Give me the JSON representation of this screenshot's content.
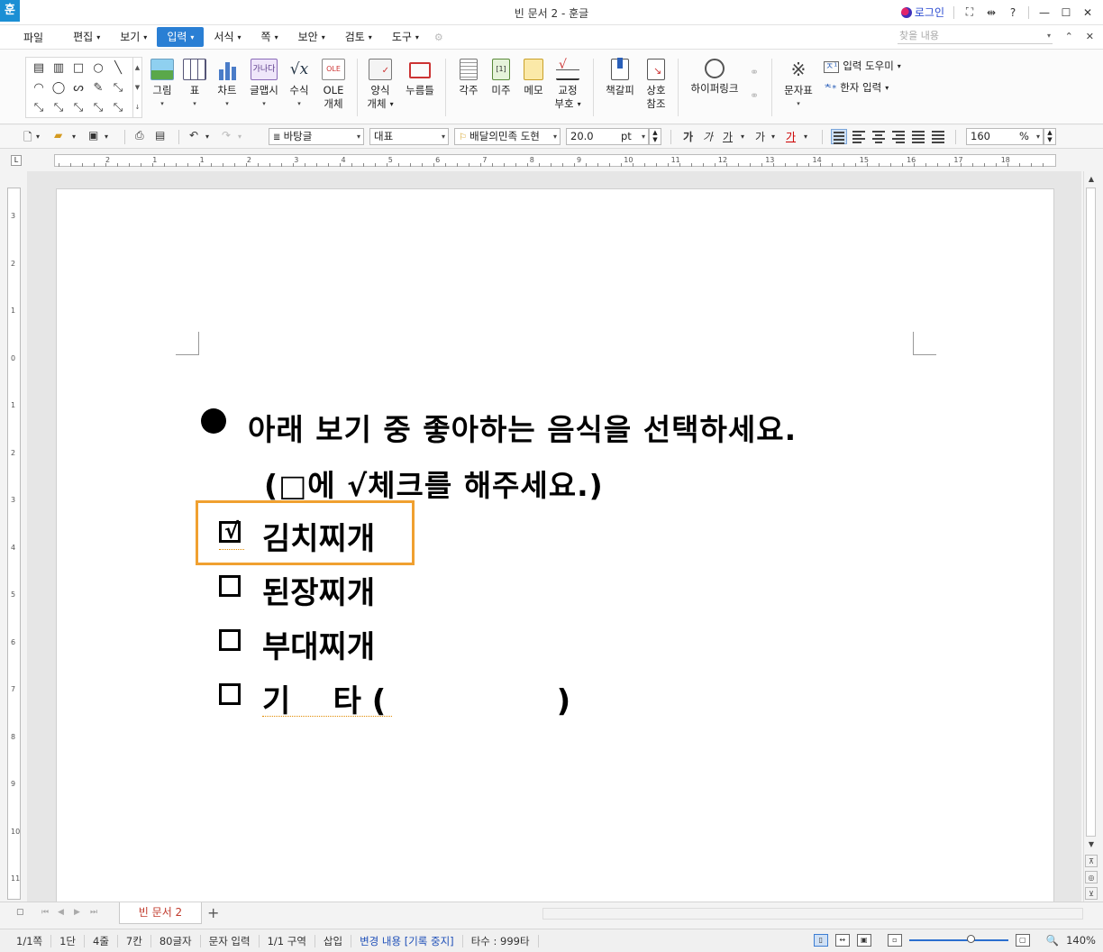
{
  "app": {
    "logo": "훈",
    "title": "빈 문서 2 - 훈글"
  },
  "title_right": {
    "login": "로그인",
    "help": "?"
  },
  "menu": {
    "file": "파일",
    "items": [
      "편집",
      "보기",
      "입력",
      "서식",
      "쪽",
      "보안",
      "검토",
      "도구"
    ],
    "active_index": 2,
    "search_placeholder": "찾을 내용"
  },
  "ribbon": {
    "buttons": [
      {
        "label": "그림",
        "icon": "picture-icon"
      },
      {
        "label": "표",
        "icon": "table-icon"
      },
      {
        "label": "차트",
        "icon": "chart-icon"
      },
      {
        "label": "글맵시",
        "icon": "wordart-icon",
        "glyph": "가나다"
      },
      {
        "label": "수식",
        "icon": "formula-icon",
        "glyph": "√x"
      },
      {
        "label": "OLE",
        "label2": "개체",
        "icon": "ole-icon",
        "glyph": "OLE"
      },
      {
        "label": "양식",
        "label2": "개체",
        "icon": "form-object-icon"
      },
      {
        "label": "누름틀",
        "icon": "click-field-icon"
      },
      {
        "label": "각주",
        "icon": "footnote-icon"
      },
      {
        "label": "미주",
        "icon": "endnote-icon",
        "glyph": "[1]"
      },
      {
        "label": "메모",
        "icon": "memo-icon"
      },
      {
        "label": "교정",
        "label2": "부호",
        "icon": "proofreading-icon"
      },
      {
        "label": "책갈피",
        "icon": "bookmark-icon"
      },
      {
        "label": "상호",
        "label2": "참조",
        "icon": "cross-reference-icon"
      },
      {
        "label": "하이퍼링크",
        "icon": "hyperlink-icon"
      },
      {
        "label": "문자표",
        "icon": "symbol-icon",
        "glyph": "※"
      }
    ],
    "side_items": [
      {
        "label": "입력 도우미",
        "glyph": "ㅈ¹"
      },
      {
        "label": "한자 입력",
        "glyph": "ᅕ*"
      }
    ],
    "shapes": [
      "▤",
      "▥",
      "□",
      "○",
      "╲",
      "◠",
      "◯",
      "ᔕ",
      "✎",
      "⤡",
      "⤡",
      "⤡",
      "⤡",
      "⤡",
      "⤡"
    ]
  },
  "toolbar": {
    "style": "바탕글",
    "lang": "대표",
    "font": "배달의민족 도현",
    "size": "20.0",
    "size_unit": "pt",
    "char_fmt": [
      "가",
      "가",
      "가",
      "가",
      "가"
    ],
    "zoom": "160",
    "zoom_unit": "%"
  },
  "ruler": {
    "h_numbers": [
      "2",
      "1",
      "1",
      "2",
      "3",
      "4",
      "5",
      "6",
      "7",
      "8",
      "9",
      "10",
      "11",
      "12",
      "13",
      "14",
      "15",
      "16",
      "17",
      "18"
    ],
    "v_numbers": [
      "3",
      "2",
      "1",
      "0",
      "1",
      "2",
      "3",
      "4",
      "5",
      "6",
      "7",
      "8",
      "9",
      "10",
      "11"
    ]
  },
  "document": {
    "line1": "아래 보기 중 좋아하는 음식을 선택하세요.",
    "line2": "(□에 √체크를 해주세요.)",
    "options": [
      {
        "label": "김치찌개",
        "checked": true
      },
      {
        "label": "된장찌개",
        "checked": false
      },
      {
        "label": "부대찌개",
        "checked": false
      },
      {
        "label": "기    타 (                )",
        "checked": false
      }
    ],
    "check_glyph": "√"
  },
  "tabs": {
    "doc_tab": "빈 문서 2",
    "add": "+"
  },
  "status": {
    "page": "1/1쪽",
    "column": "1단",
    "line": "4줄",
    "col_pos": "7칸",
    "chars": "80글자",
    "input_mode": "문자 입력",
    "section": "1/1 구역",
    "insert": "삽입",
    "track": "변경 내용 [기록 중지]",
    "typing": "타수 : 999타",
    "zoom": "140%"
  }
}
